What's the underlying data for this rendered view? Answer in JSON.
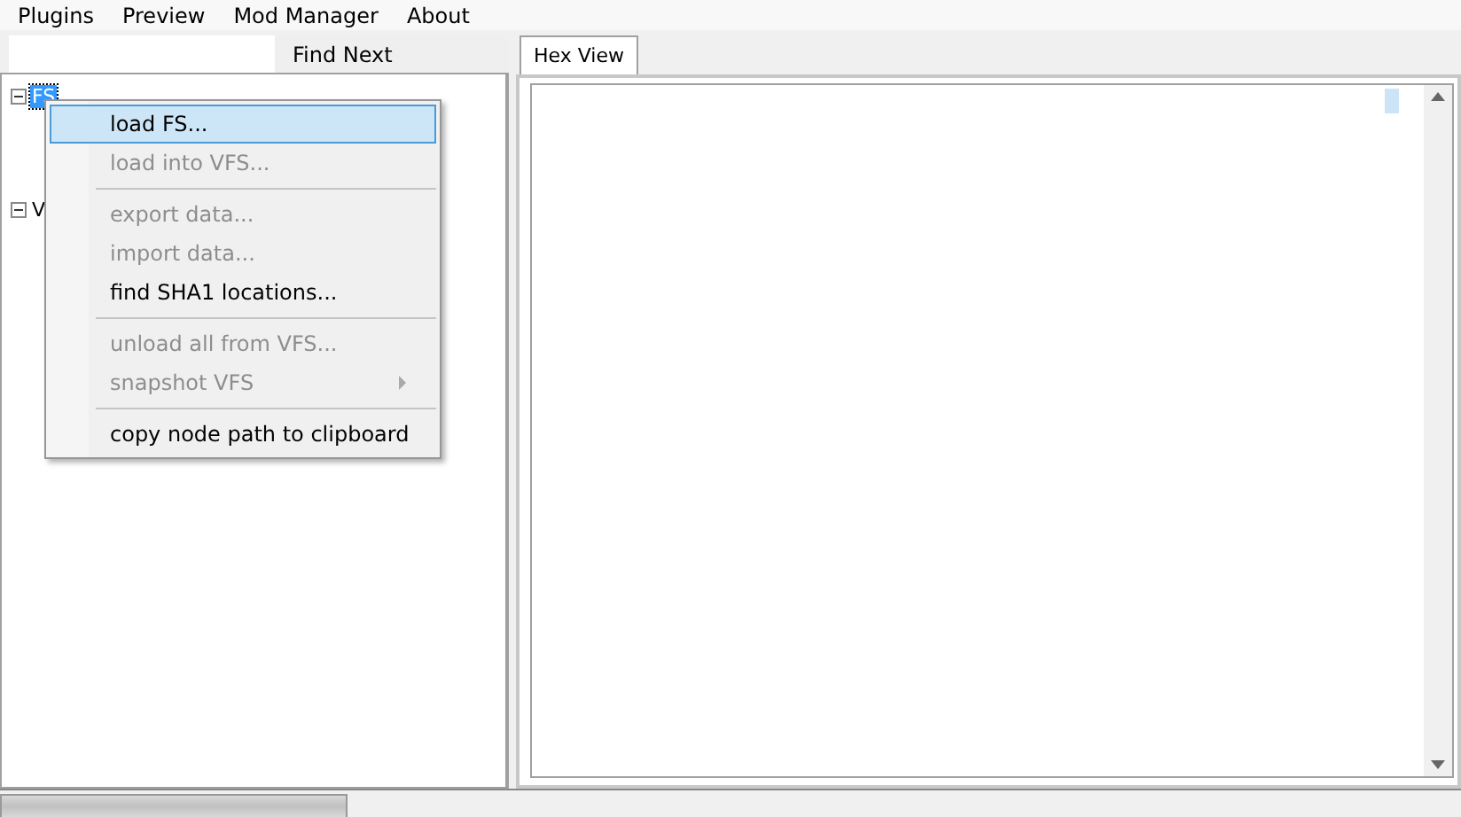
{
  "menu_bar": [
    {
      "label": "Plugins"
    },
    {
      "label": "Preview"
    },
    {
      "label": "Mod Manager"
    },
    {
      "label": "About"
    }
  ],
  "find": {
    "button": "Find Next"
  },
  "tree": [
    {
      "label": "FS",
      "expanded": true,
      "selected": true
    },
    {
      "label": "V",
      "expanded": true,
      "selected": false
    }
  ],
  "tabs": [
    {
      "label": "Hex View",
      "selected": true
    }
  ],
  "context_menu": [
    {
      "kind": "item",
      "label": "load FS...",
      "disabled": false,
      "selected": true,
      "submenu": false
    },
    {
      "kind": "item",
      "label": "load into VFS...",
      "disabled": true,
      "selected": false,
      "submenu": false
    },
    {
      "kind": "separator"
    },
    {
      "kind": "item",
      "label": "export data...",
      "disabled": true,
      "selected": false,
      "submenu": false
    },
    {
      "kind": "item",
      "label": "import data...",
      "disabled": true,
      "selected": false,
      "submenu": false
    },
    {
      "kind": "item",
      "label": "find SHA1 locations...",
      "disabled": false,
      "selected": false,
      "submenu": false
    },
    {
      "kind": "separator"
    },
    {
      "kind": "item",
      "label": "unload all from VFS...",
      "disabled": true,
      "selected": false,
      "submenu": false
    },
    {
      "kind": "item",
      "label": "snapshot VFS",
      "disabled": true,
      "selected": false,
      "submenu": true
    },
    {
      "kind": "separator"
    },
    {
      "kind": "item",
      "label": "copy node path to clipboard",
      "disabled": false,
      "selected": false,
      "submenu": false
    }
  ],
  "status_bar": {
    "progress": {
      "level": 1
    }
  }
}
